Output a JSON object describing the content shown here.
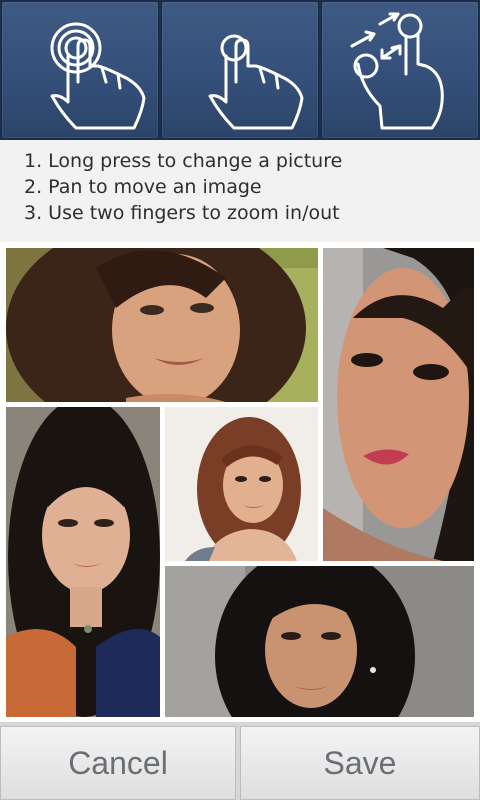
{
  "gestures": [
    {
      "icon": "long-press-icon"
    },
    {
      "icon": "pan-icon"
    },
    {
      "icon": "pinch-zoom-icon"
    }
  ],
  "instructions": [
    "1. Long press to change a picture",
    "2. Pan to move an image",
    "3. Use two fingers to zoom in/out"
  ],
  "collage": {
    "photos": [
      {
        "name": "photo-woman-smiling-outdoors"
      },
      {
        "name": "photo-woman-closeup-profile"
      },
      {
        "name": "photo-woman-long-dark-hair"
      },
      {
        "name": "photo-woman-portrait-light-background"
      },
      {
        "name": "photo-woman-smiling-gray-background"
      }
    ]
  },
  "actions": {
    "cancel_label": "Cancel",
    "save_label": "Save"
  },
  "colors": {
    "header_bg": "#1c2d4a",
    "tile": "#34507a",
    "button_text": "#6a6f76"
  }
}
